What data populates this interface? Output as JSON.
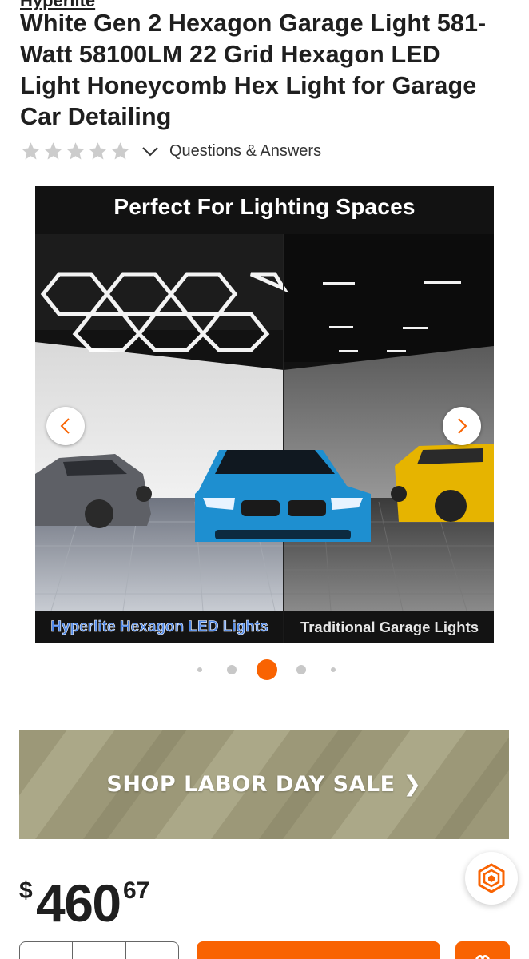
{
  "product": {
    "brand": "Hyperlite",
    "title": "White Gen 2 Hexagon Garage Light 581-Watt 58100LM 22 Grid Hexagon LED Light Honeycomb Hex Light for Garage Car Detailing",
    "rating_stars": 0,
    "qa_label": "Questions & Answers"
  },
  "gallery": {
    "heading": "Perfect For Lighting Spaces",
    "caption_left": "Hyperlite Hexagon LED Lights",
    "caption_right": "Traditional Garage Lights",
    "active_index": 2,
    "total": 5
  },
  "promo": {
    "label": "SHOP LABOR DAY SALE ❯"
  },
  "price": {
    "currency": "$",
    "dollars": "460",
    "cents": "67"
  },
  "colors": {
    "accent": "#f96302",
    "dot_active": "#f96302",
    "dot_inactive": "#c8c8c8",
    "star_empty": "#cccccc"
  },
  "icons": [
    "star-icon",
    "chevron-down-icon",
    "chevron-left-icon",
    "chevron-right-icon",
    "chat-hexagon-icon",
    "heart-icon"
  ]
}
